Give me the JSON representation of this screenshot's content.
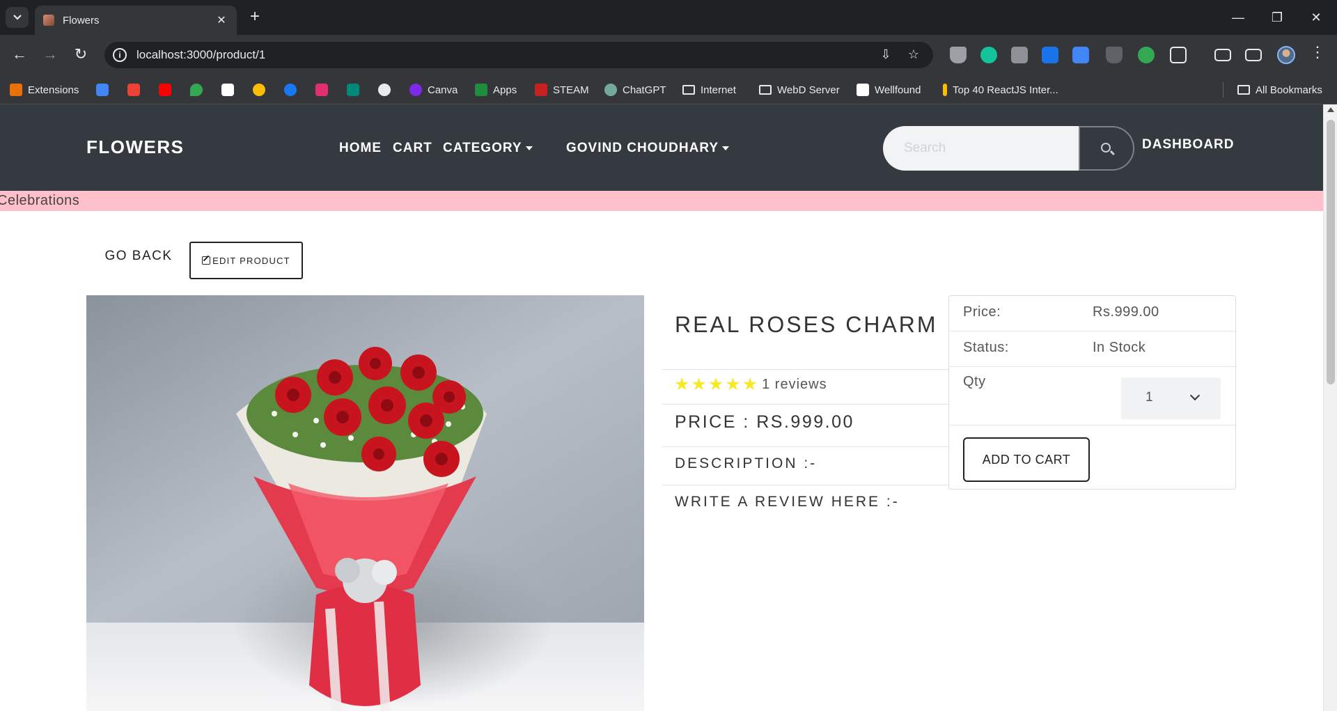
{
  "browser": {
    "tab_title": "Flowers",
    "url": "localhost:3000/product/1",
    "bookmarks": [
      {
        "label": "Extensions",
        "color": "#e8710a"
      },
      {
        "label": "Canva",
        "color": "#7d2ae8"
      },
      {
        "label": "Apps",
        "color": "#1e8e3e"
      },
      {
        "label": "STEAM",
        "color": "#c5221f"
      },
      {
        "label": "ChatGPT",
        "color": "#74aa9c"
      },
      {
        "label": "Internet"
      },
      {
        "label": "WebD Server"
      },
      {
        "label": "Wellfound",
        "color": "#ffffff"
      },
      {
        "label": "Top 40 ReactJS Inter...",
        "color": "#fbbc04"
      },
      {
        "label": "All Bookmarks"
      }
    ]
  },
  "navbar": {
    "brand": "FLOWERS",
    "links": [
      "HOME",
      "CART",
      "CATEGORY",
      "GOVIND CHOUDHARY"
    ],
    "search_placeholder": "Search",
    "dashboard": "DASHBOARD"
  },
  "marquee": "Celebrations",
  "actions": {
    "go_back": "GO BACK",
    "edit_product": "EDIT PRODUCT"
  },
  "product": {
    "name": "REAL ROSES CHARM",
    "rating": 5,
    "reviews_text": "1 reviews",
    "price_line": "PRICE : RS.999.00",
    "description_heading": "DESCRIPTION :-",
    "review_heading": "WRITE A REVIEW HERE :-"
  },
  "card": {
    "price_label": "Price:",
    "price_value": "Rs.999.00",
    "status_label": "Status:",
    "status_value": "In Stock",
    "qty_label": "Qty",
    "qty_value": "1",
    "add_to_cart": "ADD TO CART"
  },
  "colors": {
    "navbar_bg": "#343a40",
    "marquee_bg": "#ffc0cb",
    "star": "#f8e825"
  }
}
